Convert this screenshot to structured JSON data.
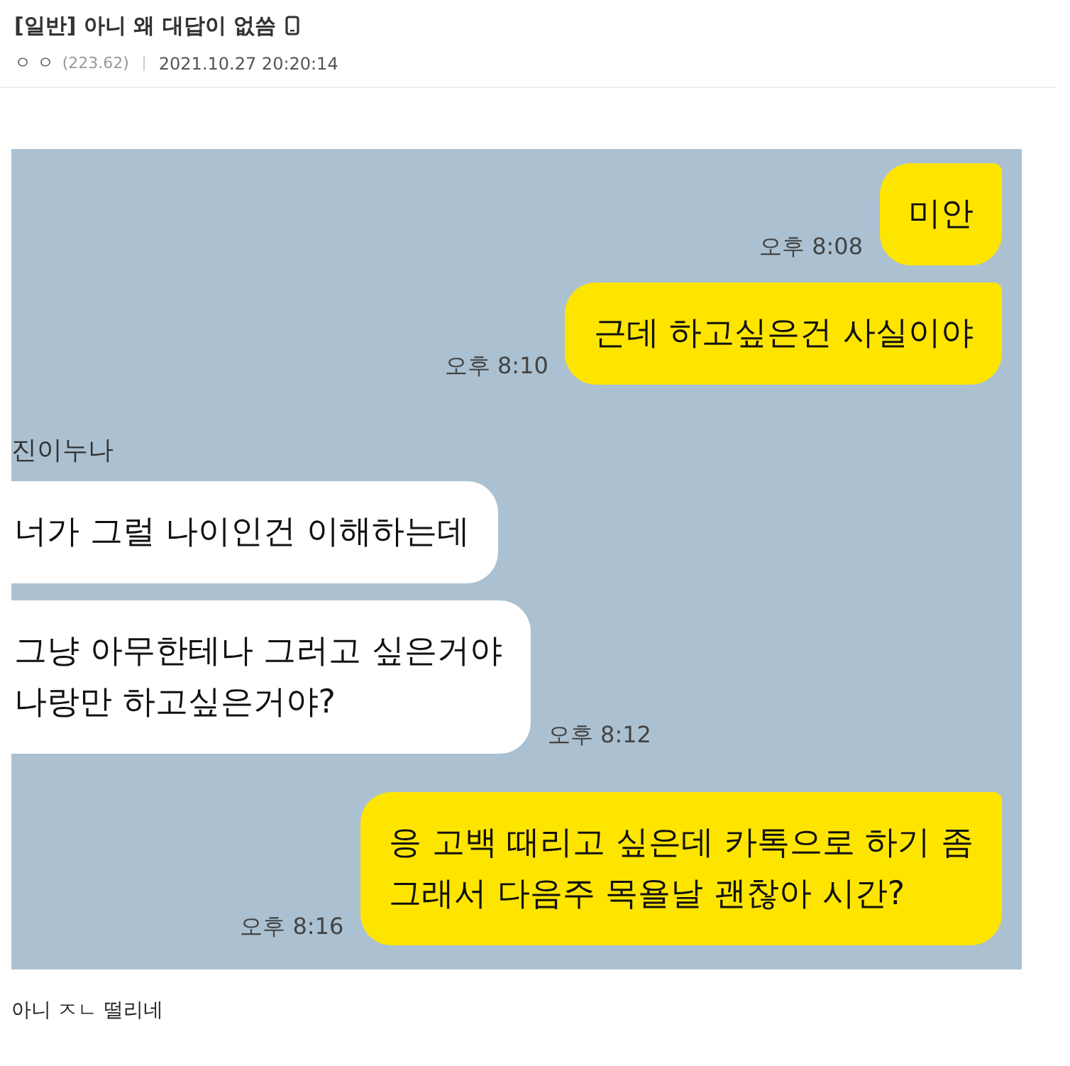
{
  "post": {
    "title": "[일반] 아니 왜 대답이 없씀",
    "author": "ㅇ ㅇ",
    "ip": "(223.62)",
    "date": "2021.10.27 20:20:14"
  },
  "chat": {
    "messages": [
      {
        "kind": "sent",
        "text": "미안",
        "time": "오후 8:08"
      },
      {
        "kind": "sent",
        "text": "근데 하고싶은건 사실이야",
        "time": "오후 8:10"
      },
      {
        "kind": "sender",
        "text": "진이누나"
      },
      {
        "kind": "received",
        "text": "너가 그럴 나이인건 이해하는데"
      },
      {
        "kind": "received",
        "text": "그냥 아무한테나 그러고 싶은거야\n나랑만 하고싶은거야?",
        "time": "오후 8:12"
      },
      {
        "kind": "sent",
        "text": "응 고백 때리고 싶은데 카톡으로 하기 좀\n그래서 다음주 목욜날 괜찮아 시간?",
        "time": "오후 8:16"
      }
    ]
  },
  "body_text": "아니 ㅈㄴ 떨리네"
}
